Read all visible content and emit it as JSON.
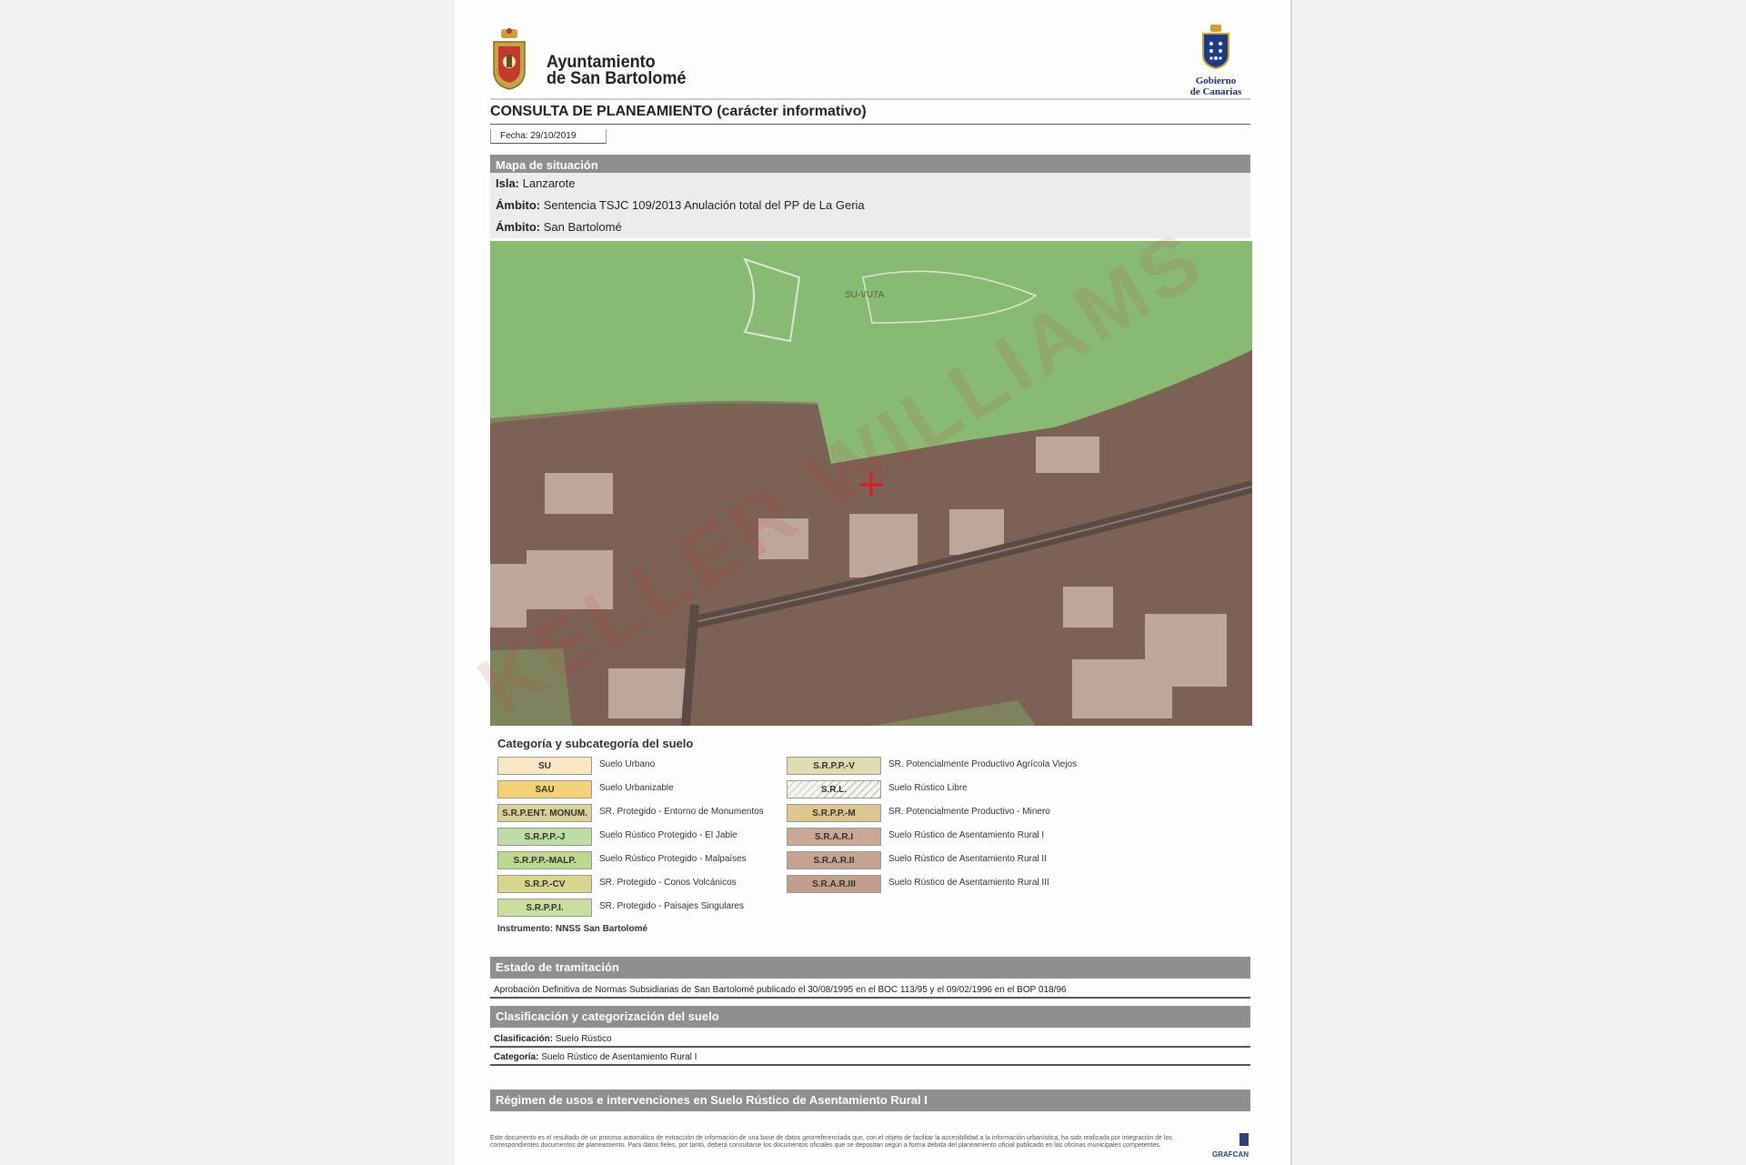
{
  "header": {
    "org_line1": "Ayuntamiento",
    "org_line2": "de San Bartolomé",
    "gov_line1": "Gobierno",
    "gov_line2": "de Canarias",
    "title": "CONSULTA DE PLANEAMIENTO (carácter informativo)",
    "date": "Fecha: 29/10/2019"
  },
  "situacion": {
    "heading": "Mapa de situación",
    "rows": [
      {
        "label": "Isla:",
        "value": "Lanzarote"
      },
      {
        "label": "Ámbito:",
        "value": "Sentencia TSJC 109/2013 Anulación total del PP de La Geria"
      },
      {
        "label": "Ámbito:",
        "value": "San Bartolomé"
      }
    ]
  },
  "map": {
    "label": "SU-VU7A"
  },
  "legend": {
    "title": "Categoría y subcategoría del suelo",
    "left": [
      {
        "code": "SU",
        "text": "Suelo Urbano",
        "color": "#f8e7c2"
      },
      {
        "code": "SAU",
        "text": "Suelo Urbanizable",
        "color": "#f4d078"
      },
      {
        "code": "S.R.P.ENT. MONUM.",
        "text": "SR. Protegido - Entorno de Monumentos",
        "color": "#d8d29a"
      },
      {
        "code": "S.R.P.P.-J",
        "text": "Suelo Rústico Protegido - El Jable",
        "color": "#bfdca6"
      },
      {
        "code": "S.R.P.P.-MALP.",
        "text": "Suelo Rústico Protegido - Malpaíses",
        "color": "#bcd88e"
      },
      {
        "code": "S.R.P.-CV",
        "text": "SR. Protegido - Conos Volcánicos",
        "color": "#d6d68e"
      },
      {
        "code": "S.R.P.P.I.",
        "text": "SR. Protegido - Paisajes Singulares",
        "color": "#c9dea0"
      }
    ],
    "right": [
      {
        "code": "S.R.P.P.-V",
        "text": "SR. Potencialmente Productivo Agrícola Viejos",
        "color": "#dedcb0"
      },
      {
        "code": "S.R.L.",
        "text": "Suelo Rústico Libre",
        "color": "#f5f5f0"
      },
      {
        "code": "S.R.P.P.-M",
        "text": "SR. Potencialmente Productivo - Minero",
        "color": "#dcc58e"
      },
      {
        "code": "S.R.A.R.I",
        "text": "Suelo Rústico de Asentamiento Rural I",
        "color": "#c9a896"
      },
      {
        "code": "S.R.A.R.II",
        "text": "Suelo Rústico de Asentamiento Rural II",
        "color": "#c6a290"
      },
      {
        "code": "S.R.A.R.III",
        "text": "Suelo Rústico de Asentamiento Rural III",
        "color": "#c39e8c"
      }
    ],
    "instrument": "Instrumento: NNSS San Bartolomé"
  },
  "tramitacion": {
    "heading": "Estado de tramitación",
    "text": "Aprobación Definitiva de Normas Subsidiarias de San Bartolomé publicado el 30/08/1995 en el BOC 113/95 y el 09/02/1996 en el BOP 018/96"
  },
  "clasificacion": {
    "heading": "Clasificación y categorización del suelo",
    "clas_label": "Clasificación:",
    "clas_value": "Suelo Rústico",
    "cat_label": "Categoría:",
    "cat_value": "Suelo Rústico de Asentamiento Rural I"
  },
  "regimen": {
    "heading": "Régimen de usos e intervenciones en Suelo Rústico de Asentamiento Rural I"
  },
  "footer": {
    "text": "Este documento es el resultado de un proceso automático de extracción de información de una base de datos georreferenciada que, con el objeto de facilitar la accesibilidad a la información urbanística, ha sido realizada por integración de los correspondientes documentos de planeamiento. Para datos fieles, por tanto, deberá consultarse los documentos oficiales que se depositan según a forma debida del planeamiento oficial publicado en las oficinas municipales competentes.",
    "logo": "GRAFCAN"
  },
  "watermark": "KELLER WILLIAMS"
}
